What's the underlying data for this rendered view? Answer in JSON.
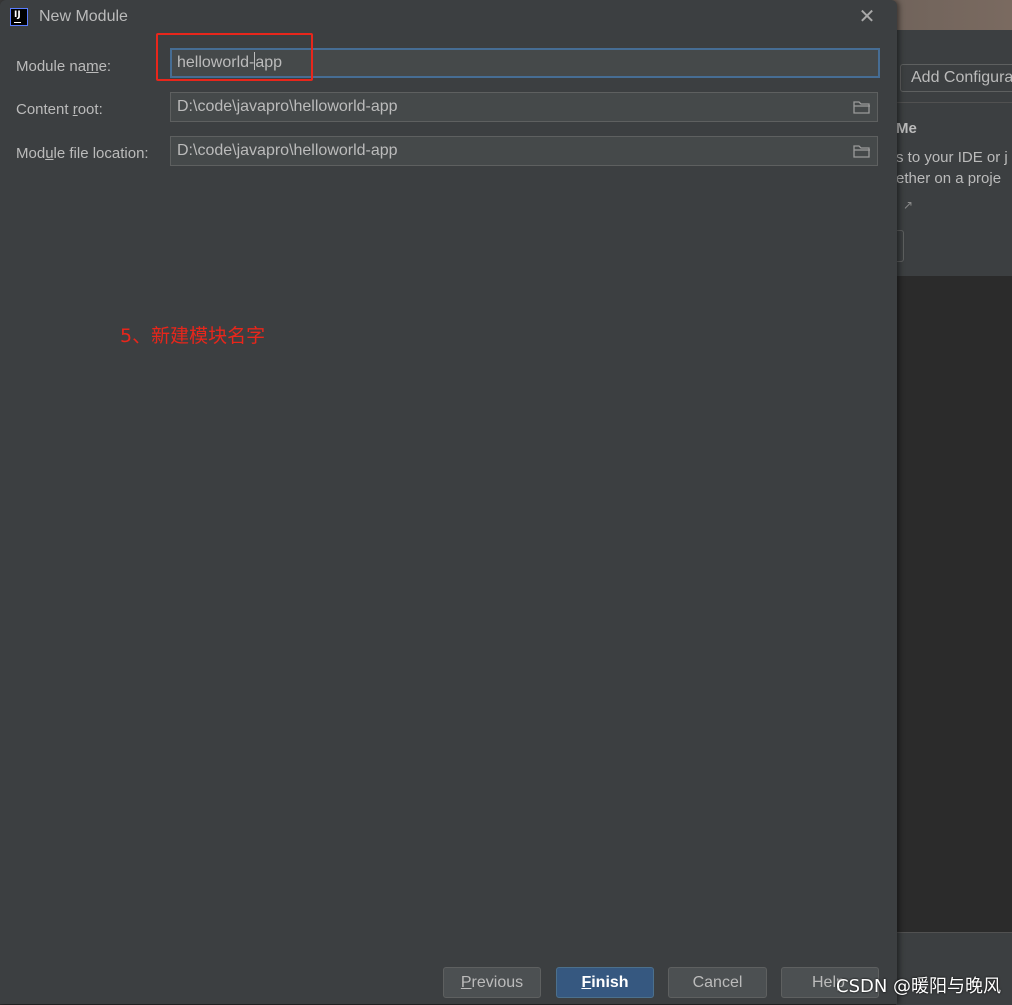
{
  "background": {
    "toolbar_button": "Add Configura",
    "panel_title": "Me",
    "panel_line1": "s to your IDE or j",
    "panel_line2": "ether on a proje"
  },
  "dialog": {
    "title": "New Module",
    "fields": {
      "module_name": {
        "label_pre": "Module na",
        "label_u": "m",
        "label_post": "e:",
        "value_pre": "helloworld-",
        "value_post": "app"
      },
      "content_root": {
        "label_pre": "Content ",
        "label_u": "r",
        "label_post": "oot:",
        "value": "D:\\code\\javapro\\helloworld-app"
      },
      "module_file_location": {
        "label_pre": "Mod",
        "label_u": "u",
        "label_post": "le file location:",
        "value": "D:\\code\\javapro\\helloworld-app"
      }
    },
    "buttons": {
      "previous_u": "P",
      "previous_rest": "revious",
      "finish_u": "F",
      "finish_rest": "inish",
      "cancel": "Cancel",
      "help": "Help"
    }
  },
  "annotation": "5、新建模块名字",
  "watermark": "CSDN @暖阳与晚风",
  "colors": {
    "highlight": "#e8261b",
    "primary_button": "#365880",
    "dialog_bg": "#3c3f41"
  },
  "icons": [
    "intellij-app-icon",
    "close-icon",
    "folder-icon"
  ]
}
